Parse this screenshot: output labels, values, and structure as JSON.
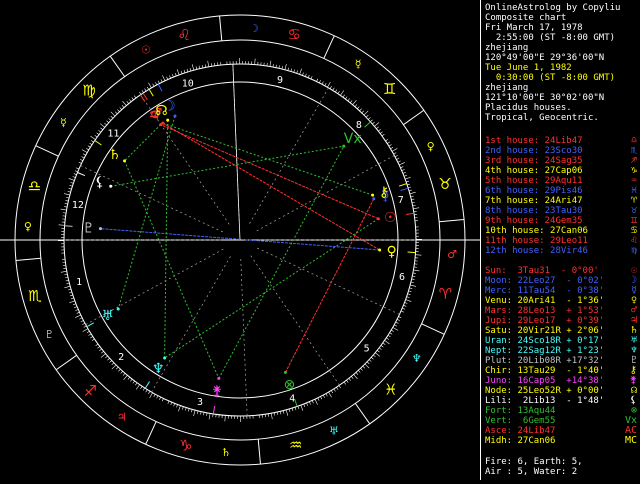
{
  "header": [
    {
      "text": "OnlineAstrolog by Copyliu",
      "color": "#ffffff"
    },
    {
      "text": "Composite chart",
      "color": "#ffffff"
    },
    {
      "text": "Fri March 17, 1978",
      "color": "#ffffff"
    },
    {
      "text": "  2:55:00 (ST -8:00 GMT)",
      "color": "#ffffff"
    },
    {
      "text": "zhejiang",
      "color": "#ffffff"
    },
    {
      "text": "120°49'00\"E 29°36'00\"N",
      "color": "#ffffff"
    },
    {
      "text": "Tue June 1, 1982",
      "color": "#ffff00"
    },
    {
      "text": "  0:30:00 (ST -8:00 GMT)",
      "color": "#ffff00"
    },
    {
      "text": "zhejiang",
      "color": "#ffffff"
    },
    {
      "text": "121°10'00\"E 30°02'00\"N",
      "color": "#ffffff"
    },
    {
      "text": "Placidus houses.",
      "color": "#ffffff"
    },
    {
      "text": "Tropical, Geocentric.",
      "color": "#ffffff"
    }
  ],
  "houses": [
    {
      "text": "1st house: 24Lib47",
      "color": "#ff3030",
      "glyph": "♎"
    },
    {
      "text": "2nd house: 23Sco30",
      "color": "#4060ff",
      "glyph": "♏"
    },
    {
      "text": "3rd house: 24Sag35",
      "color": "#ff3030",
      "glyph": "♐"
    },
    {
      "text": "4th house: 27Cap06",
      "color": "#ffff00",
      "glyph": "♑"
    },
    {
      "text": "5th house: 29Aqu11",
      "color": "#ff3030",
      "glyph": "♒"
    },
    {
      "text": "6th house: 29Pis46",
      "color": "#4060ff",
      "glyph": "♓"
    },
    {
      "text": "7th house: 24Ari47",
      "color": "#ffff00",
      "glyph": "♈"
    },
    {
      "text": "8th house: 23Tau30",
      "color": "#4060ff",
      "glyph": "♉"
    },
    {
      "text": "9th house: 24Gem35",
      "color": "#ff3030",
      "glyph": "♊"
    },
    {
      "text": "10th house: 27Can06",
      "color": "#ffff00",
      "glyph": "♋"
    },
    {
      "text": "11th house: 29Leo11",
      "color": "#ff3030",
      "glyph": "♌"
    },
    {
      "text": "12th house: 28Vir46",
      "color": "#4060ff",
      "glyph": "♍"
    }
  ],
  "planets": [
    {
      "text": "Sun:  3Tau31  - 0°00'",
      "color": "#ff3030",
      "glyph": "☉"
    },
    {
      "text": "Moon: 22Leo27  - 0°02'",
      "color": "#4060ff",
      "glyph": "☽"
    },
    {
      "text": "Merc: 11Tau54  - 0°38'",
      "color": "#4060ff",
      "glyph": "☿"
    },
    {
      "text": "Venu: 20Ari41  - 1°36'",
      "color": "#ffff00",
      "glyph": "♀"
    },
    {
      "text": "Mars: 28Leo13  + 1°53'",
      "color": "#ff3030",
      "glyph": "♂"
    },
    {
      "text": "Jupi: 29Leo17  + 0°39'",
      "color": "#ff3030",
      "glyph": "♃"
    },
    {
      "text": "Satu: 20Vir21R + 2°06'",
      "color": "#ffff00",
      "glyph": "♄"
    },
    {
      "text": "Uran: 24Sco18R + 0°17'",
      "color": "#40ffff",
      "glyph": "♅"
    },
    {
      "text": "Nept: 22Sag12R + 1°23'",
      "color": "#40ffff",
      "glyph": "♆"
    },
    {
      "text": "Plut: 20Lib08R +17°32'",
      "color": "#c0c0c0",
      "glyph": "♇"
    },
    {
      "text": "Chir: 13Tau29  - 1°40'",
      "color": "#ffff00",
      "glyph": "⚷"
    },
    {
      "text": "Juno: 16Cap05  +14°38'",
      "color": "#ff40ff",
      "glyph": "⚵"
    },
    {
      "text": "Node: 25Leo52R + 0°00'",
      "color": "#ffff00",
      "glyph": "☊"
    },
    {
      "text": "Lili:  2Lib13  - 1°48'",
      "color": "#ffffff",
      "glyph": "⚸"
    },
    {
      "text": "Fort: 13Aqu44",
      "color": "#30c030",
      "glyph": "⊗"
    },
    {
      "text": "Vert:  6Gem55",
      "color": "#30c030",
      "glyph": "Vx"
    },
    {
      "text": "Asce: 24Lib47",
      "color": "#ff3030",
      "glyph": "AC"
    },
    {
      "text": "Midh: 27Can06",
      "color": "#ffff00",
      "glyph": "MC"
    }
  ],
  "summary": [
    {
      "text": "Fire: 6, Earth: 5,",
      "color": "#ffffff"
    },
    {
      "text": "Air : 5, Water: 2",
      "color": "#ffffff"
    }
  ],
  "wheel": {
    "signs": [
      {
        "glyph": "♈",
        "color": "#ff3030"
      },
      {
        "glyph": "♉",
        "color": "#ffff00"
      },
      {
        "glyph": "♊",
        "color": "#ffff00"
      },
      {
        "glyph": "♋",
        "color": "#ff3030"
      },
      {
        "glyph": "♌",
        "color": "#ff3030"
      },
      {
        "glyph": "♍",
        "color": "#ffff00"
      },
      {
        "glyph": "♎",
        "color": "#ffff00"
      },
      {
        "glyph": "♏",
        "color": "#ffff00"
      },
      {
        "glyph": "♐",
        "color": "#ff3030"
      },
      {
        "glyph": "♑",
        "color": "#ff3030"
      },
      {
        "glyph": "♒",
        "color": "#ffff00"
      },
      {
        "glyph": "♓",
        "color": "#ffff00"
      }
    ],
    "rulers": [
      {
        "glyph": "♂",
        "color": "#ff3030"
      },
      {
        "glyph": "♀",
        "color": "#ffff00"
      },
      {
        "glyph": "☿",
        "color": "#ffff00"
      },
      {
        "glyph": "☽",
        "color": "#4060ff"
      },
      {
        "glyph": "☉",
        "color": "#ff3030"
      },
      {
        "glyph": "☿",
        "color": "#ffff00"
      },
      {
        "glyph": "♀",
        "color": "#ffff00"
      },
      {
        "glyph": "♇",
        "color": "#c0c0c0"
      },
      {
        "glyph": "♃",
        "color": "#ff3030"
      },
      {
        "glyph": "♄",
        "color": "#ffff00"
      },
      {
        "glyph": "♅",
        "color": "#40ffff"
      },
      {
        "glyph": "♆",
        "color": "#40ffff"
      }
    ],
    "house_cusps_deg": [
      204.78,
      233.5,
      264.58,
      297.1,
      329.18,
      359.77,
      24.78,
      53.5,
      84.58,
      117.1,
      149.18,
      179.77
    ],
    "house_numbers": [
      "1",
      "2",
      "3",
      "4",
      "5",
      "6",
      "7",
      "8",
      "9",
      "10",
      "11",
      "12"
    ],
    "planets": [
      {
        "glyph": "☉",
        "lon": 33.52,
        "color": "#ff3030"
      },
      {
        "glyph": "☽",
        "lon": 142.45,
        "color": "#4060ff"
      },
      {
        "glyph": "☿",
        "lon": 41.9,
        "color": "#4060ff"
      },
      {
        "glyph": "♀",
        "lon": 20.68,
        "color": "#ffff00"
      },
      {
        "glyph": "♂",
        "lon": 148.22,
        "color": "#ff3030"
      },
      {
        "glyph": "♃",
        "lon": 149.28,
        "color": "#ff3030"
      },
      {
        "glyph": "♄",
        "lon": 170.35,
        "color": "#ffff00"
      },
      {
        "glyph": "♅",
        "lon": 234.3,
        "color": "#40ffff"
      },
      {
        "glyph": "♆",
        "lon": 262.2,
        "color": "#40ffff"
      },
      {
        "glyph": "♇",
        "lon": 200.13,
        "color": "#c0c0c0"
      },
      {
        "glyph": "⚷",
        "lon": 43.48,
        "color": "#ffff00"
      },
      {
        "glyph": "⚵",
        "lon": 286.08,
        "color": "#ff40ff"
      },
      {
        "glyph": "☊",
        "lon": 145.87,
        "color": "#ffff00"
      },
      {
        "glyph": "⚸",
        "lon": 182.22,
        "color": "#ffffff"
      },
      {
        "glyph": "⊗",
        "lon": 313.73,
        "color": "#30c030"
      },
      {
        "glyph": "Vx",
        "lon": 66.92,
        "color": "#30c030"
      }
    ],
    "aspects": [
      {
        "a": 3,
        "b": 4,
        "color": "#ff3030"
      },
      {
        "a": 0,
        "b": 5,
        "color": "#ff3030"
      },
      {
        "a": 2,
        "b": 14,
        "color": "#ff3030"
      },
      {
        "a": 3,
        "b": 9,
        "color": "#4060ff"
      },
      {
        "a": 0,
        "b": 8,
        "color": "#30c030"
      },
      {
        "a": 4,
        "b": 10,
        "color": "#30c030"
      },
      {
        "a": 6,
        "b": 11,
        "color": "#30c030"
      },
      {
        "a": 1,
        "b": 7,
        "color": "#30c030"
      },
      {
        "a": 12,
        "b": 8,
        "color": "#30c030"
      },
      {
        "a": 13,
        "b": 15,
        "color": "#30c030"
      },
      {
        "a": 11,
        "b": 15,
        "color": "#30c030"
      },
      {
        "a": 5,
        "b": 6,
        "color": "#30c030"
      }
    ]
  }
}
